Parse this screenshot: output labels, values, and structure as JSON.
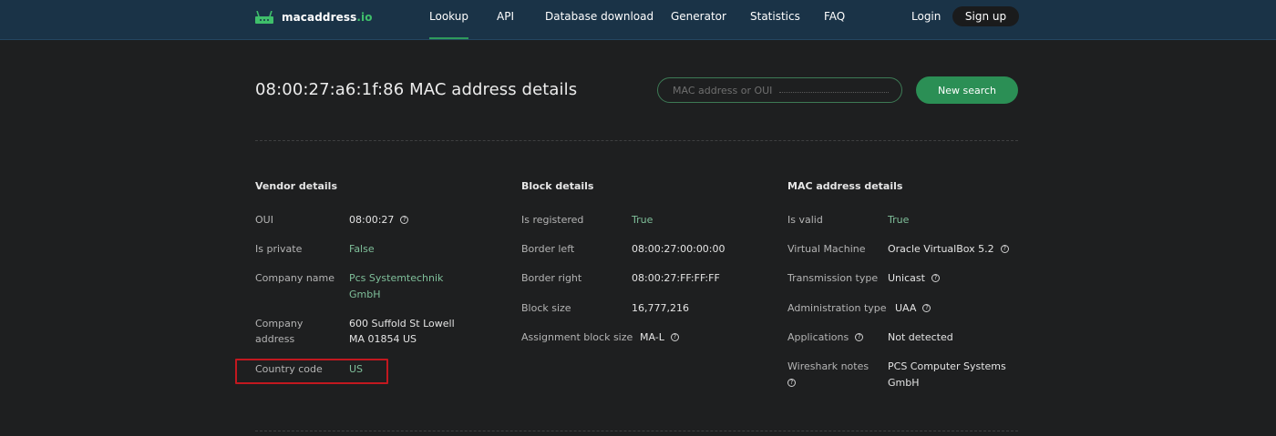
{
  "header": {
    "logo_main": "macaddress",
    "logo_tld": ".io",
    "nav": [
      "Lookup",
      "API",
      "Database download",
      "Generator",
      "Statistics",
      "FAQ"
    ],
    "active_nav": "Lookup",
    "login": "Login",
    "signup": "Sign up"
  },
  "title": "08:00:27:a6:1f:86 MAC address details",
  "search": {
    "placeholder": "MAC address or OUI",
    "button": "New search"
  },
  "vendor": {
    "title": "Vendor details",
    "oui_label": "OUI",
    "oui_value": "08:00:27",
    "private_label": "Is private",
    "private_value": "False",
    "company_label": "Company name",
    "company_value_1": "Pcs Systemtechnik",
    "company_value_2": "GmbH",
    "address_label_1": "Company",
    "address_label_2": "address",
    "address_value_1": "600 Suffold St Lowell",
    "address_value_2": "MA 01854 US",
    "country_label": "Country code",
    "country_value": "US"
  },
  "block": {
    "title": "Block details",
    "registered_label": "Is registered",
    "registered_value": "True",
    "left_label": "Border left",
    "left_value": "08:00:27:00:00:00",
    "right_label": "Border right",
    "right_value": "08:00:27:FF:FF:FF",
    "size_label": "Block size",
    "size_value": "16,777,216",
    "assign_label": "Assignment block size",
    "assign_value": "MA-L"
  },
  "mac": {
    "title": "MAC address details",
    "valid_label": "Is valid",
    "valid_value": "True",
    "vm_label": "Virtual Machine",
    "vm_value": "Oracle VirtualBox 5.2",
    "tx_label": "Transmission type",
    "tx_value": "Unicast",
    "admin_label": "Administration type",
    "admin_value": "UAA",
    "apps_label": "Applications",
    "apps_value": "Not detected",
    "wireshark_label": "Wireshark notes",
    "wireshark_value_1": "PCS Computer Systems",
    "wireshark_value_2": "GmbH"
  },
  "icons": {
    "help": "?"
  },
  "colors": {
    "header_bg": "#1a3347",
    "page_bg": "#1e1f20",
    "accent_green": "#2b8f55",
    "value_green": "#7fbf9a",
    "highlight_red": "#c2181f"
  }
}
